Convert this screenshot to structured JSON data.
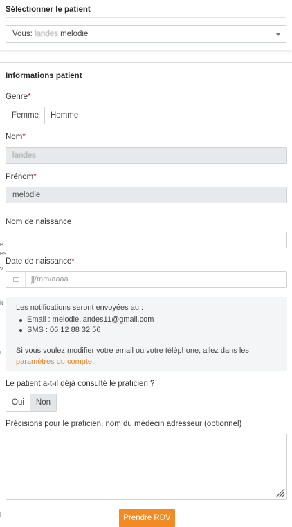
{
  "select_patient": {
    "title": "Sélectionner le patient",
    "prefix": "Vous: ",
    "last_name": "landes",
    "first_name": "melodie"
  },
  "patient_info": {
    "title": "Informations patient",
    "genre_label": "Genre",
    "genre_options": [
      "Femme",
      "Homme"
    ],
    "nom_label": "Nom",
    "nom_value": "landes",
    "prenom_label": "Prénom",
    "prenom_value": "melodie",
    "nom_naissance_label": "Nom de naissance",
    "nom_naissance_value": "",
    "date_naissance_label": "Date de naissance",
    "date_placeholder": "jj/mm/aaaa",
    "required_marker": "*"
  },
  "notice": {
    "title": "Les notifications seront envoyées au :",
    "items": [
      "Email : melodie.landes11@gmail.com",
      "SMS : 06 12 88 32 56"
    ],
    "text": "Si vous voulez modifier votre email ou votre téléphone, allez dans les",
    "link": "paramètres du compte",
    "link_suffix": "."
  },
  "consulted": {
    "question": "Le patient a-t-il déjà consulté le praticien ?",
    "options": [
      "Oui",
      "Non"
    ],
    "selected": "Non"
  },
  "precisions": {
    "label": "Précisions pour le praticien, nom du médecin adresseur (optionnel)",
    "value": ""
  },
  "submit_label": "Prendre RDV",
  "edge_marks": [
    "e",
    "es",
    "8",
    "v",
    "lt",
    "r",
    "l"
  ],
  "colors": {
    "accent": "#f28b24",
    "link": "#e8842b",
    "required": "#d0021b",
    "selected_bg": "#e3e6e9",
    "notice_bg": "#f4f5f7"
  }
}
